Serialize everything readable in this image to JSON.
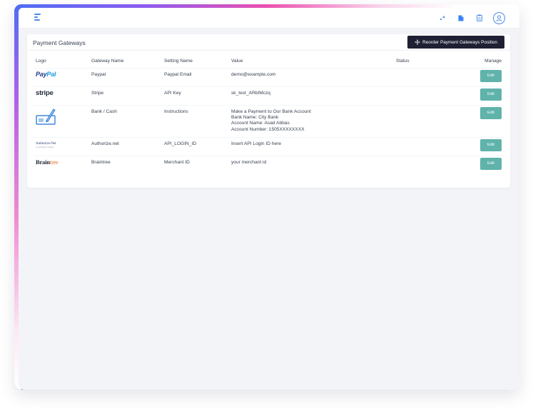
{
  "card": {
    "title": "Payment Gateways",
    "reorder_label": "Reorder Payment Gateways Position"
  },
  "table": {
    "headers": {
      "logo": "Logo",
      "gateway_name": "Gateway Name",
      "setting_name": "Setting Name",
      "value": "Value",
      "status": "Status",
      "manage": "Manage"
    },
    "edit_label": "Edit",
    "rows": [
      {
        "logo": {
          "a": "Pay",
          "b": "Pal"
        },
        "gateway_name": "Paypal",
        "setting_name": "Paypal Email",
        "value": [
          "demo@example.com"
        ]
      },
      {
        "logo": {
          "a": "stripe"
        },
        "gateway_name": "Stripe",
        "setting_name": "API Key",
        "value": [
          "sk_test_ARbIMczq"
        ]
      },
      {
        "logo": {},
        "gateway_name": "Bank / Cash",
        "setting_name": "Instructions",
        "value": [
          "Make a Payment to Our Bank Account",
          "Bank Name: City Bank",
          "Account Name: Asad Abbas",
          "Account Number: 1505XXXXXXXX"
        ]
      },
      {
        "logo": {
          "a": "Authorize.Net",
          "b": "A CyberSource Solution"
        },
        "gateway_name": "Authorize.net",
        "setting_name": "API_LOGIN_ID",
        "value": [
          "Insert API Login ID here"
        ]
      },
      {
        "logo": {
          "a": "Brain",
          "b": "tree"
        },
        "gateway_name": "Braintree",
        "setting_name": "Merchant ID",
        "value": [
          "your merchant id"
        ]
      }
    ]
  },
  "colors": {
    "accent": "#4b8be6",
    "edit_button": "#5fb3aa",
    "dark_button": "#1f2033"
  },
  "icons": {
    "topbar": [
      "menu-icon",
      "sparkle-icon",
      "document-icon",
      "clipboard-icon",
      "user-avatar-icon"
    ],
    "reorder": "move-arrows-icon"
  }
}
